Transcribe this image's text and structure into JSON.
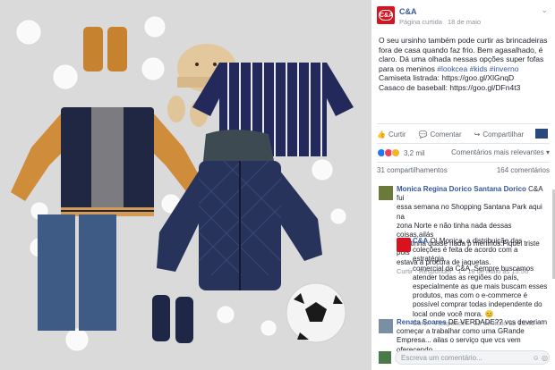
{
  "page": {
    "name": "C&A",
    "logo_text": "C&A",
    "meta_type": "Página curtida",
    "meta_date": "18 de maio",
    "menu_icon": "chevron-down-icon"
  },
  "post": {
    "lines": [
      "O seu ursinho também pode curtir as brincadeiras",
      "fora de casa quando faz frio. Bem agasalhado, é",
      "claro. Dá uma olhada nessas opções super fofas",
      "para os meninos"
    ],
    "hashtags": "#lookcea #kids #inverno",
    "link1": "Camiseta listrada: https://goo.gl/XlGnqD",
    "link2": "Casaco de baseball: https://goo.gl/DFn4t3"
  },
  "actions": {
    "like": "Curtir",
    "comment": "Comentar",
    "share": "Compartilhar"
  },
  "reactions": {
    "count": "3,2 mil",
    "sort": "Comentários mais relevantes",
    "colors": [
      "#2078f4",
      "#f33e58",
      "#f7b125"
    ]
  },
  "stats": {
    "shares": "31 compartilhamentos",
    "comments": "164 comentários"
  },
  "comments": [
    {
      "name": "Monica Regina Dorico Santana Dorico",
      "lines": [
        "C&A fui",
        "essa semana no Shopping Santana Park aqui na",
        "zona Norte e não tinha nada dessas coisas,ailás",
        "não tinha quase nada p meninos.Fiquei triste pois",
        "estava a procura de jaquetas."
      ],
      "meta": "Curtir · Responder · 1 · 18 de maio às 15:56"
    },
    {
      "name": "C&A",
      "lines": [
        "Oi Monica, a distribuição das",
        "coleções é feita de acordo com a estratégia",
        "comercial da C&A. Sempre buscamos",
        "atender todas as regiões do país,",
        "especialmente as que mais buscam esses",
        "produtos, mas com o e-commerce é",
        "possível comprar todas independente do",
        "local onde você mora. 😊"
      ],
      "meta": "Curtir · Responder · 22 de maio às 15:40"
    },
    {
      "name": "Renata Soares",
      "lines": [
        "DE VERDADE?? vcs deveriam",
        "começar a trabalhar como uma GRande",
        "Empresa... ailas o serviço que vcs vem oferecendo"
      ]
    }
  ],
  "reply": {
    "placeholder": "Escreva um comentário..."
  }
}
